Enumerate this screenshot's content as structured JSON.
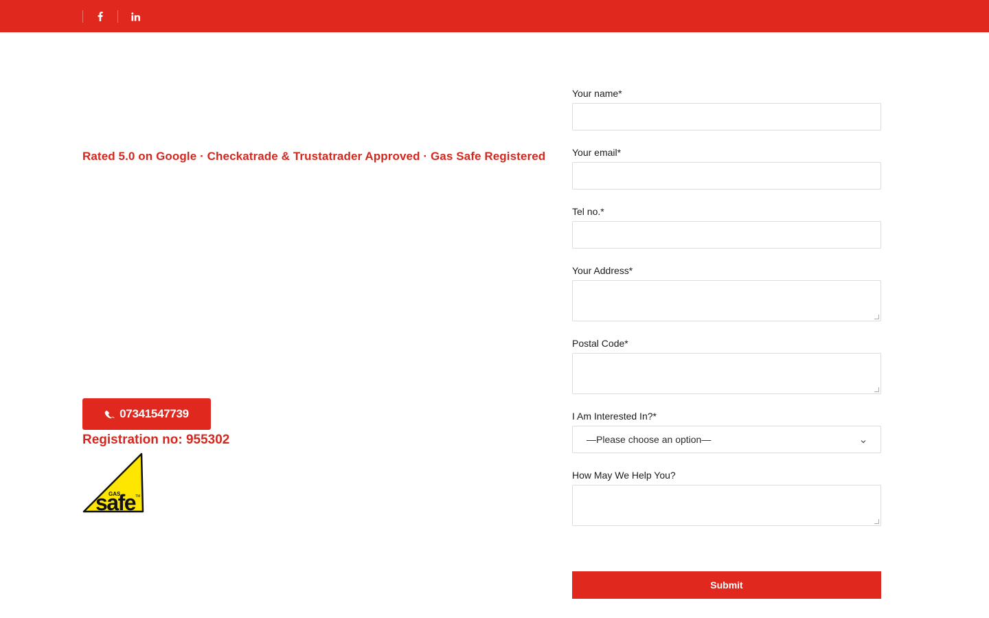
{
  "social": {
    "facebook_icon": "facebook-icon",
    "linkedin_icon": "linkedin-icon"
  },
  "tagline": "Rated 5.0 on Google · Checkatrade & Trustatrader Approved · Gas Safe Registered",
  "phone": {
    "icon": "phone-icon",
    "number": "07341547739"
  },
  "registration": "Registration no: 955302",
  "gas_safe_logo": {
    "small_text": "GAS",
    "main_text": "safe"
  },
  "form": {
    "name_label": "Your name*",
    "email_label": "Your email*",
    "tel_label": "Tel no.*",
    "address_label": "Your Address*",
    "postal_label": "Postal Code*",
    "interest_label": "I Am Interested In?*",
    "interest_selected": "—Please choose an option—",
    "help_label": "How May We Help You?",
    "submit_label": "Submit"
  },
  "colors": {
    "brand_red": "#e0281f",
    "text_red": "#d4281f",
    "logo_yellow": "#ffe600"
  }
}
